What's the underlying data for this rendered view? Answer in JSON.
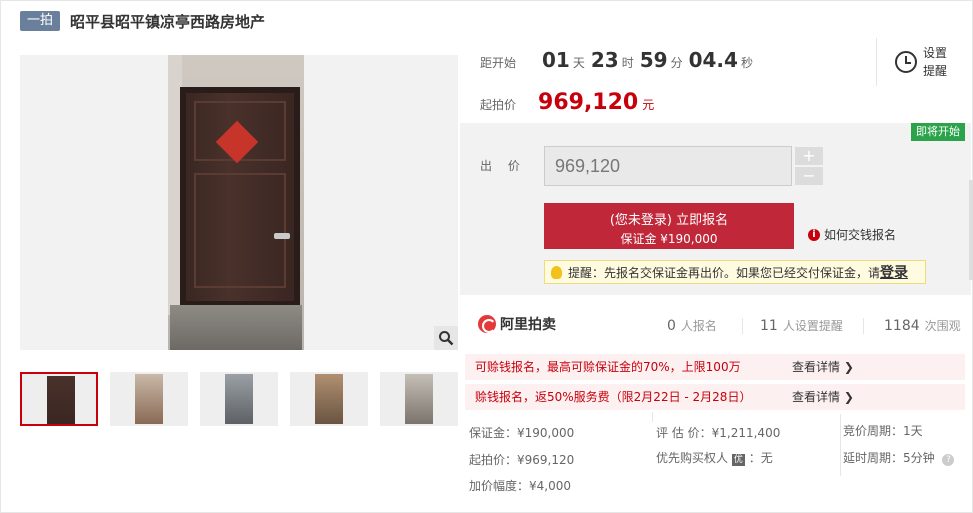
{
  "header": {
    "tag": "一拍",
    "title": "昭平县昭平镇凉亭西路房地产"
  },
  "countdown": {
    "label": "距开始",
    "days": "01",
    "days_unit": "天",
    "hours": "23",
    "hours_unit": "时",
    "minutes": "59",
    "minutes_unit": "分",
    "seconds": "04.4",
    "seconds_unit": "秒"
  },
  "reminder": {
    "label": "设置提醒",
    "icon": "alarm-clock-icon"
  },
  "start_price": {
    "label": "起拍价",
    "value": "969,120",
    "unit": "元"
  },
  "status_badge": "即将开始",
  "bid": {
    "label": "出 价",
    "value": "969,120",
    "plus": "+",
    "minus": "−"
  },
  "signup_button": {
    "line1": "(您未登录) 立即报名",
    "line2": "保证金 ¥190,000"
  },
  "how_to_pay": "如何交钱报名",
  "tip": {
    "text": "提醒：先报名交保证金再出价。如果您已经交付保证金，请",
    "login": "登录"
  },
  "brand": "阿里拍卖",
  "stats": {
    "registered": "0",
    "registered_label": "人报名",
    "reminders": "11",
    "reminders_label": "人设置提醒",
    "views": "1184",
    "views_label": "次围观"
  },
  "promos": [
    {
      "text": "可赊钱报名，最高可赊保证金的70%，上限100万",
      "more": "查看详情 ❯"
    },
    {
      "text": "赊钱报名，返50%服务费（限2月22日 - 2月28日）",
      "more": "查看详情 ❯"
    }
  ],
  "details": {
    "deposit": "保证金：¥190,000",
    "start_price": "起拍价：¥969,120",
    "increment": "加价幅度：¥4,000",
    "appraisal": "评 估 价：¥1,211,400",
    "priority_label": "优先购买权人",
    "priority_tag": "优",
    "priority_value": "：无",
    "bid_cycle": "竞价周期：1天",
    "extension": "延时周期：5分钟"
  },
  "colors": {
    "accent": "#c7000b",
    "button": "#c0283a",
    "badge_green": "#2aa34a",
    "tag_blue": "#6a7f9b"
  }
}
